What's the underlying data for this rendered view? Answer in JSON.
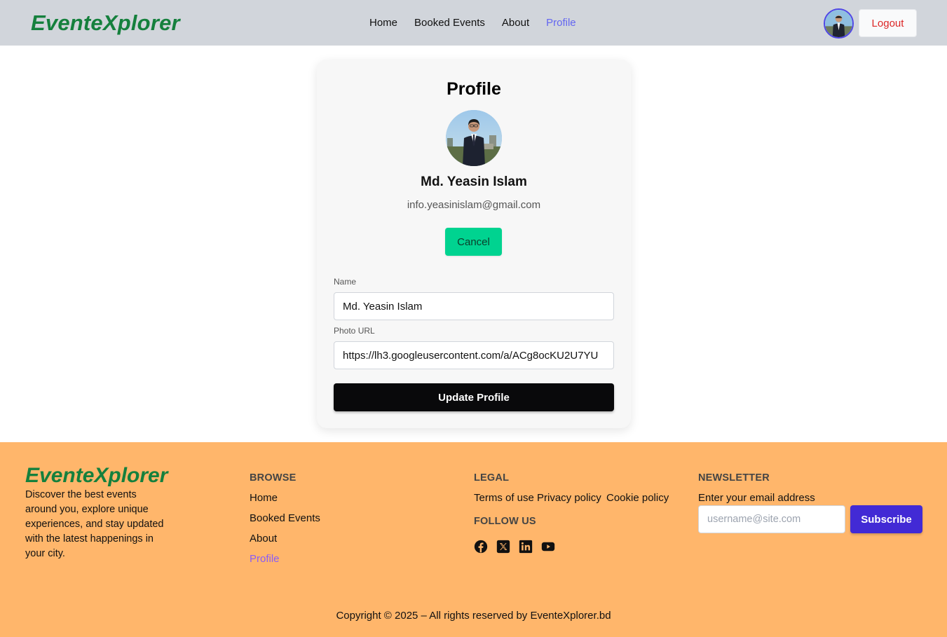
{
  "navbar": {
    "brand": "EventeXplorer",
    "links": [
      "Home",
      "Booked Events",
      "About",
      "Profile"
    ],
    "active_link": "Profile",
    "logout_label": "Logout"
  },
  "profile": {
    "title": "Profile",
    "name": "Md. Yeasin Islam",
    "email": "info.yeasinislam@gmail.com",
    "cancel_label": "Cancel",
    "form": {
      "name_label": "Name",
      "name_value": "Md. Yeasin Islam",
      "photo_label": "Photo URL",
      "photo_value": "https://lh3.googleusercontent.com/a/ACg8ocKU2U7YU",
      "submit_label": "Update Profile"
    }
  },
  "footer": {
    "brand": "EventeXplorer",
    "description": "Discover the best events around you, explore unique experiences, and stay updated with the latest happenings in your city.",
    "browse": {
      "title": "BROWSE",
      "links": [
        "Home",
        "Booked Events",
        "About",
        "Profile"
      ]
    },
    "legal": {
      "title": "LEGAL",
      "links": [
        "Terms of use",
        "Privacy policy",
        "Cookie policy"
      ]
    },
    "follow": {
      "title": "FOLLOW US",
      "icons": [
        "facebook-icon",
        "x-icon",
        "linkedin-icon",
        "youtube-icon"
      ]
    },
    "newsletter": {
      "title": "NEWSLETTER",
      "label": "Enter your email address",
      "placeholder": "username@site.com",
      "button_label": "Subscribe"
    },
    "copyright": "Copyright © 2025 – All rights reserved by EventeXplorer.bd"
  },
  "colors": {
    "brand": "#15803d",
    "navbar_bg": "#d1d5db",
    "active_link": "#6366f1",
    "cancel_bg": "#00d390",
    "update_bg": "#09090b",
    "footer_bg": "#ffb66b",
    "subscribe_bg": "#422ad5",
    "logout_text": "#dc2626"
  }
}
